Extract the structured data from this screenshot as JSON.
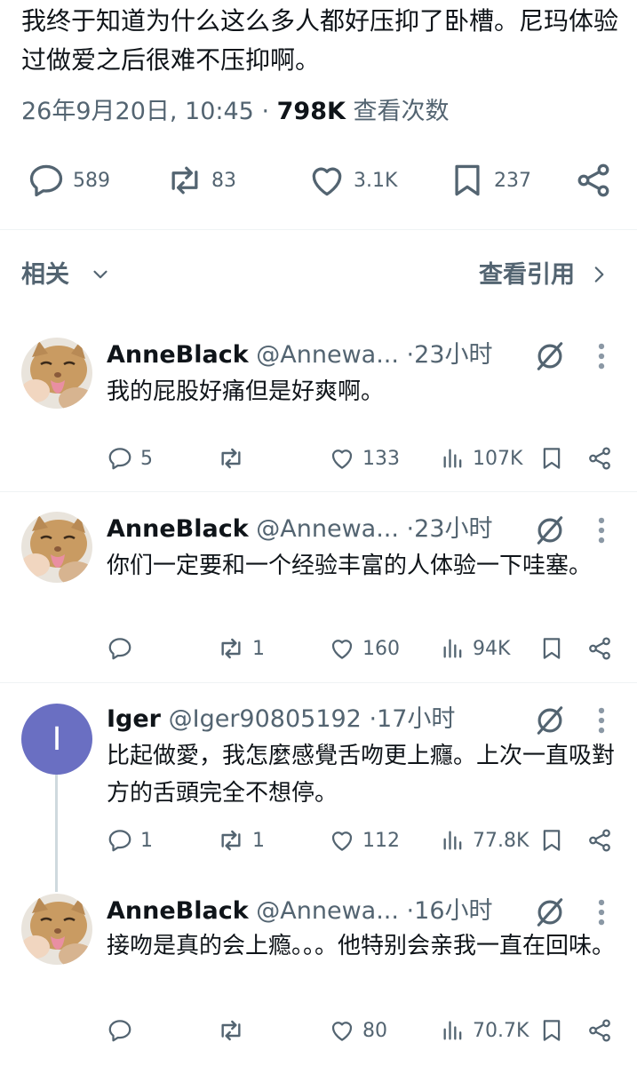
{
  "post": {
    "text": "我终于知道为什么这么多人都好压抑了卧槽。尼玛体验过做爱之后很难不压抑啊。",
    "timestamp": "26年9月20日, 10:45 · ",
    "views_count": "798K",
    "views_label": " 查看次数",
    "actions": {
      "replies": "589",
      "reposts": "83",
      "likes": "3.1K",
      "bookmarks": "237"
    }
  },
  "related": {
    "label": "相关",
    "quotes_link": "查看引用"
  },
  "replies": [
    {
      "name": "AnneBlack",
      "handle": "@Annewa...",
      "time": "23小时",
      "text": "我的屁股好痛但是好爽啊。",
      "stats": {
        "replies": "5",
        "reposts": "",
        "likes": "133",
        "views": "107K"
      }
    },
    {
      "name": "AnneBlack",
      "handle": "@Annewa...",
      "time": "23小时",
      "text": "你们一定要和一个经验丰富的人体验一下哇塞。",
      "stats": {
        "replies": "",
        "reposts": "1",
        "likes": "160",
        "views": "94K"
      }
    },
    {
      "name": "Iger",
      "handle": "@Iger90805192",
      "time": "17小时",
      "avatar_letter": "I",
      "text": "比起做愛，我怎麼感覺舌吻更上癮。上次一直吸對方的舌頭完全不想停。",
      "stats": {
        "replies": "1",
        "reposts": "1",
        "likes": "112",
        "views": "77.8K"
      }
    },
    {
      "name": "AnneBlack",
      "handle": "@Annewa...",
      "time": "16小时",
      "text": "接吻是真的会上瘾。。。他特别会亲我一直在回味。",
      "stats": {
        "replies": "",
        "reposts": "",
        "likes": "80",
        "views": "70.7K"
      }
    }
  ],
  "colors": {
    "text": "#0f1419",
    "secondary": "#536471",
    "divider": "#eff3f4",
    "avatar_purple": "#6a6fc2"
  },
  "icons": [
    "reply-icon",
    "repost-icon",
    "like-icon",
    "bookmark-icon",
    "share-icon",
    "grok-icon",
    "more-icon",
    "views-icon",
    "chevron-down-icon",
    "chevron-right-icon"
  ]
}
